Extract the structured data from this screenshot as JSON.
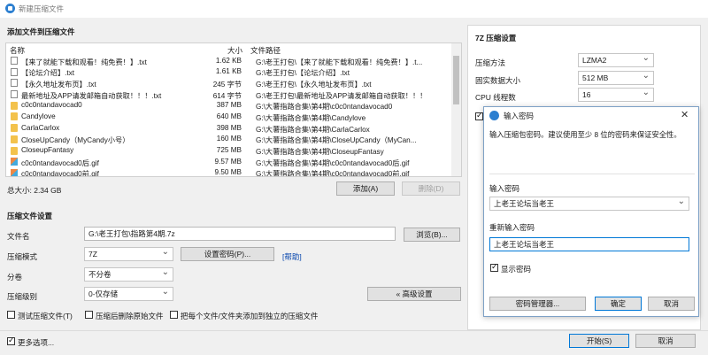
{
  "window": {
    "title": "新建压缩文件"
  },
  "files_section": {
    "title": "添加文件到压缩文件",
    "columns": {
      "name": "名称",
      "size": "大小",
      "path": "文件路径"
    },
    "rows": [
      {
        "icon": "txt",
        "name": "【来了就能下载和观看！纯免费！】.txt",
        "size": "1.62 KB",
        "path": "G:\\老王打包\\【来了就能下载和观看！纯免费！】.t..."
      },
      {
        "icon": "txt",
        "name": "【论坛介绍】.txt",
        "size": "1.61 KB",
        "path": "G:\\老王打包\\【论坛介绍】.txt"
      },
      {
        "icon": "txt",
        "name": "【永久地址发布页】.txt",
        "size": "245 字节",
        "path": "G:\\老王打包\\【永久地址发布页】.txt"
      },
      {
        "icon": "txt",
        "name": "最新地址及APP请发邮箱自动获取！！！.txt",
        "size": "614 字节",
        "path": "G:\\老王打包\\最新地址及APP请发邮箱自动获取！！！"
      },
      {
        "icon": "folder",
        "name": "c0c0ntandavocad0",
        "size": "387 MB",
        "path": "G:\\大薯指路合集\\第4期\\c0c0ntandavocad0"
      },
      {
        "icon": "folder",
        "name": "Candylove",
        "size": "640 MB",
        "path": "G:\\大薯指路合集\\第4期\\Candylove"
      },
      {
        "icon": "folder",
        "name": "CarlaCarlox",
        "size": "398 MB",
        "path": "G:\\大薯指路合集\\第4期\\CarlaCarlox"
      },
      {
        "icon": "folder",
        "name": "CloseUpCandy（MyCandy小号）",
        "size": "160 MB",
        "path": "G:\\大薯指路合集\\第4期\\CloseUpCandy（MyCan..."
      },
      {
        "icon": "folder",
        "name": "CloseupFantasy",
        "size": "725 MB",
        "path": "G:\\大薯指路合集\\第4期\\CloseupFantasy"
      },
      {
        "icon": "gif",
        "name": "c0c0ntandavocad0后.gif",
        "size": "9.57 MB",
        "path": "G:\\大薯指路合集\\第4期\\c0c0ntandavocad0后.gif"
      },
      {
        "icon": "gif",
        "name": "c0c0ntandavocad0前.gif",
        "size": "9.50 MB",
        "path": "G:\\大薯指路合集\\第4期\\c0c0ntandavocad0前.gif"
      }
    ],
    "total": "总大小: 2.34 GB",
    "add_button": "添加(A)",
    "delete_button": "删除(D)"
  },
  "settings_section": {
    "title": "压缩文件设置",
    "filename_label": "文件名",
    "filename_value": "G:\\老王打包\\指路第4期.7z",
    "browse_button": "浏览(B)...",
    "format_label": "压缩模式",
    "format_value": "7Z",
    "set_password_button": "设置密码(P)...",
    "help_link": "[帮助]",
    "split_label": "分卷",
    "split_value": "不分卷",
    "level_label": "压缩级别",
    "level_value": "0-仅存储",
    "advanced_button": "« 高级设置",
    "test_archive": "测试压缩文件(T)",
    "delete_after": "压缩后删除原始文件",
    "each_separate": "把每个文件/文件夹添加到独立的压缩文件",
    "more_options": "更多选项...",
    "start_button": "开始(S)",
    "cancel_button": "取消"
  },
  "seven_zip": {
    "title": "7Z 压缩设置",
    "method_label": "压缩方法",
    "method_value": "LZMA2",
    "dict_label": "固实数据大小",
    "dict_value": "512 MB",
    "threads_label": "CPU 线程数",
    "threads_value": "16"
  },
  "password_dialog": {
    "title": "输入密码",
    "close": "✕",
    "description": "输入压缩包密码。建议使用至少 8 位的密码来保证安全性。",
    "enter_label": "输入密码",
    "enter_value": "上老王论坛当老王",
    "reenter_label": "重新输入密码",
    "reenter_value": "上老王论坛当老王",
    "show_password": "显示密码",
    "manager_button": "密码管理器...",
    "ok_button": "确定",
    "cancel_button": "取消"
  }
}
